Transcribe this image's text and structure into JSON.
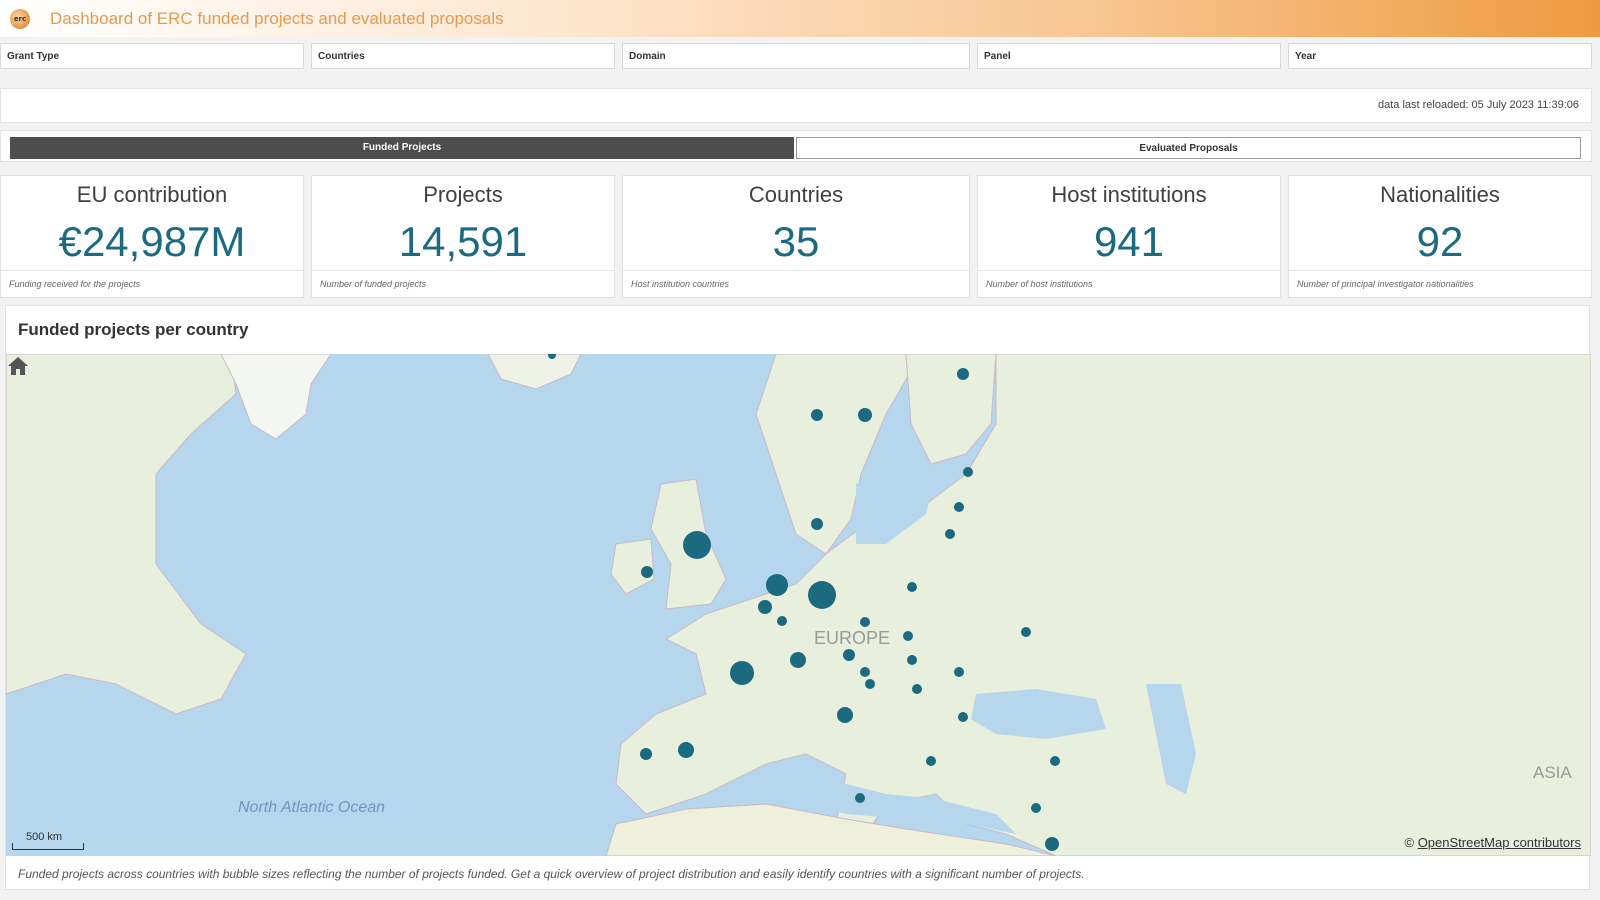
{
  "header": {
    "logo_text": "erc",
    "title": "Dashboard of ERC funded projects and evaluated proposals"
  },
  "filters": [
    "Grant Type",
    "Countries",
    "Domain",
    "Panel",
    "Year"
  ],
  "reload": {
    "text": "data last reloaded: 05 July 2023 11:39:06"
  },
  "tabs": [
    "Funded Projects",
    "Evaluated Proposals"
  ],
  "kpis": [
    {
      "title": "EU contribution",
      "value": "€24,987M",
      "footer": "Funding received for the projects"
    },
    {
      "title": "Projects",
      "value": "14,591",
      "footer": "Number of funded projects"
    },
    {
      "title": "Countries",
      "value": "35",
      "footer": "Host institution countries"
    },
    {
      "title": "Host institutions",
      "value": "941",
      "footer": "Number of host institutions"
    },
    {
      "title": "Nationalities",
      "value": "92",
      "footer": "Number of principal investigator nationalities"
    }
  ],
  "map": {
    "title": "Funded projects per country",
    "labels": {
      "europe": "EUROPE",
      "ocean": "North Atlantic Ocean",
      "asia": "ASIA"
    },
    "scale": "500 km",
    "attribution_symbol": "©",
    "attribution_link": "OpenStreetMap contributors",
    "caption": "Funded projects across countries with bubble sizes reflecting the number of projects funded. Get a quick overview of project distribution and easily identify countries with a significant number of projects."
  },
  "colors": {
    "accent": "#1b6a80",
    "header_orange": "#ef9a3f",
    "tab_active": "#4d4d4d"
  }
}
